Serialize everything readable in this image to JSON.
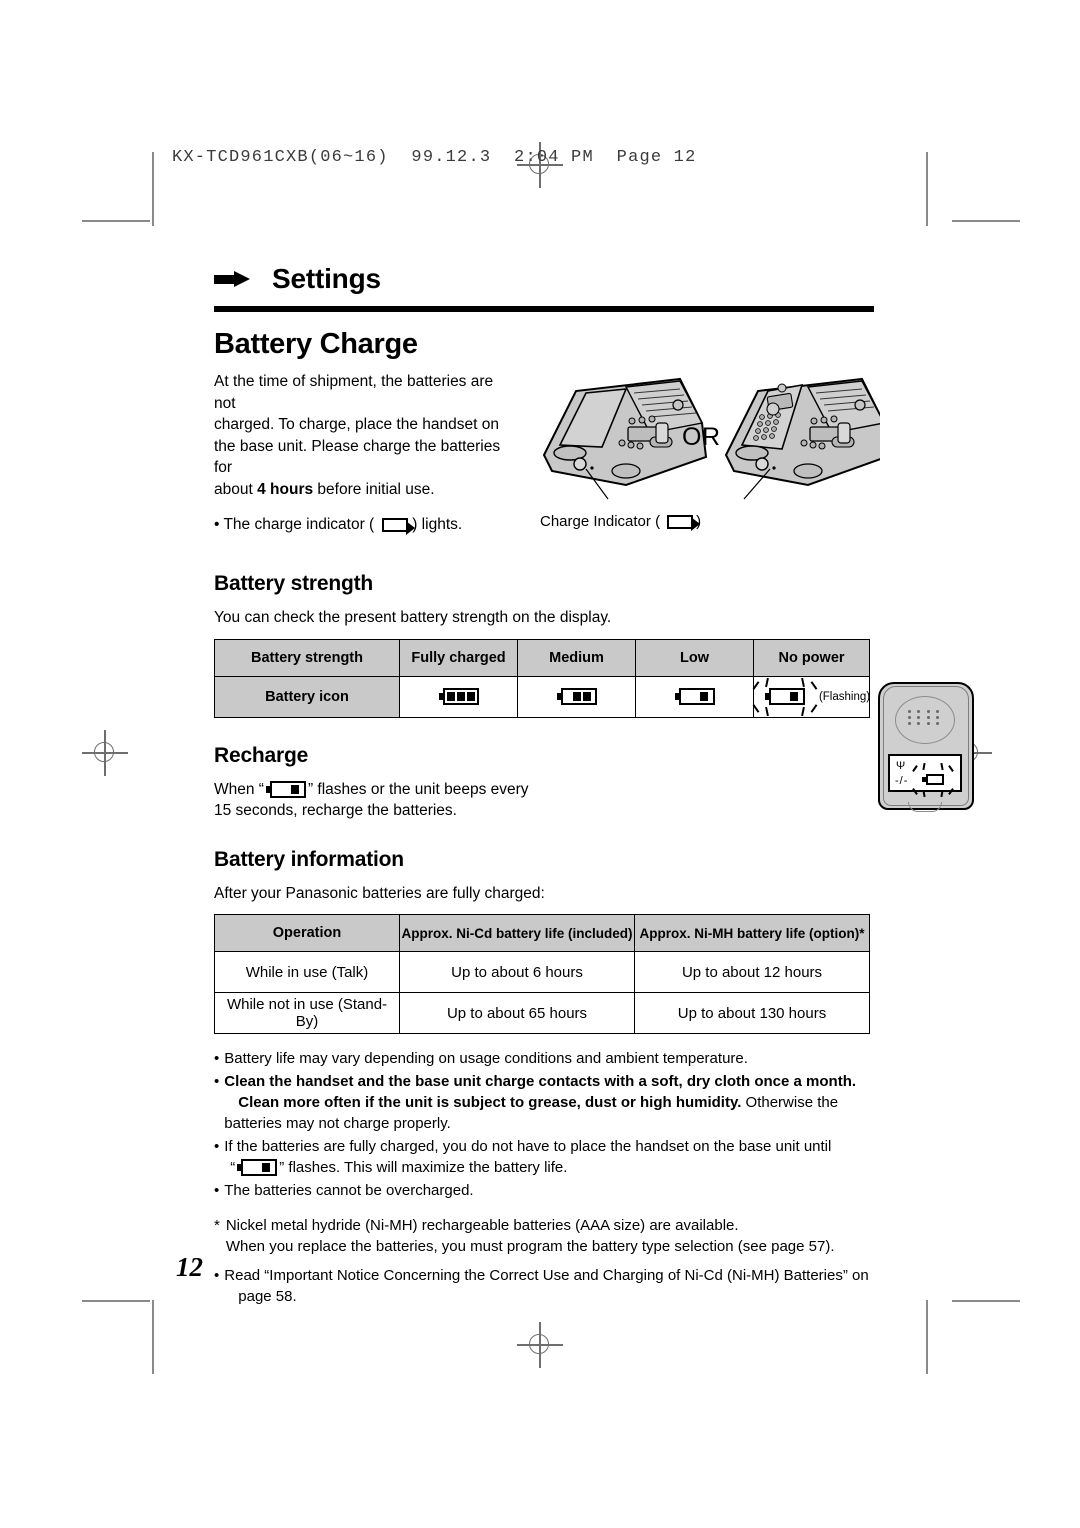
{
  "film_header": "KX-TCD961CXB(06~16)  99.12.3  2:04 PM  Page 12",
  "chapter": {
    "label": "Settings"
  },
  "page_title": "Battery Charge",
  "intro": {
    "line1": "At the time of shipment, the batteries are not",
    "line2": "charged. To charge, place the handset on",
    "line3": "the base unit. Please charge the batteries for",
    "line4_pre": "about ",
    "line4_bold": "4 hours",
    "line4_post": " before initial use.",
    "bullet_pre": "The charge indicator (",
    "bullet_post": ") lights."
  },
  "illustration": {
    "or_label": "OR",
    "caption_pre": "Charge Indicator (",
    "caption_post": ")"
  },
  "battery_strength": {
    "heading": "Battery strength",
    "intro": "You can check the present battery strength on the display.",
    "table": {
      "row1_label": "Battery strength",
      "row1_values": [
        "Fully charged",
        "Medium",
        "Low",
        "No power"
      ],
      "row2_label": "Battery icon",
      "row2_cells": [
        3,
        2,
        1,
        1
      ],
      "flashing_note": "(Flashing)"
    }
  },
  "recharge": {
    "heading": "Recharge",
    "text_pre": "When “",
    "text_mid": "” flashes or the unit beeps every",
    "text_line2": "15 seconds, recharge the batteries."
  },
  "handset_display": {
    "antenna": "Ψ",
    "dashes": "-/-"
  },
  "battery_information": {
    "heading": "Battery information",
    "intro": "After your Panasonic batteries are fully charged:",
    "table": {
      "headers": [
        "Operation",
        "Approx. Ni-Cd battery life (included)",
        "Approx. Ni-MH battery life (option)*"
      ],
      "rows": [
        [
          "While in use (Talk)",
          "Up to about 6 hours",
          "Up to about 12 hours"
        ],
        [
          "While not in use (Stand-By)",
          "Up to about 65 hours",
          "Up to about 130 hours"
        ]
      ]
    }
  },
  "notes": {
    "n1": "Battery life may vary depending on usage conditions and ambient temperature.",
    "n2_bold_line1": "Clean the handset and the base unit charge contacts with a soft, dry cloth once a month.",
    "n2_bold_line2": "Clean more often if the unit is subject to grease, dust or high humidity.",
    "n2_normal": " Otherwise the batteries may not charge properly.",
    "n3_line1": "If the batteries are fully charged, you do not have to place the handset on the base unit until",
    "n3_quote_open": "“",
    "n3_line2_post": "” flashes. This will maximize the battery life.",
    "n4": "The batteries cannot be overcharged.",
    "footnote_star": "*",
    "footnote_line1": "Nickel metal hydride (Ni-MH) rechargeable batteries (AAA size) are available.",
    "footnote_line2": "When you replace the batteries, you must program the battery type selection (see page 57).",
    "n5_line1": "Read “Important Notice Concerning the Correct Use and Charging of Ni-Cd (Ni-MH) Batteries” on",
    "n5_line2": "page 58.",
    "bullet_char": "•"
  },
  "page_number": "12"
}
